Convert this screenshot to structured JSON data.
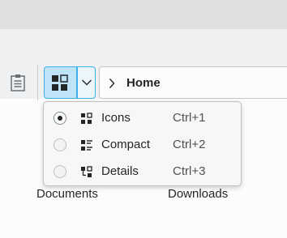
{
  "window": {
    "location_crumb": "Home"
  },
  "view_mode_menu": {
    "items": [
      {
        "label": "Icons",
        "shortcut": "Ctrl+1",
        "checked": true,
        "icon": "view-icons-icon"
      },
      {
        "label": "Compact",
        "shortcut": "Ctrl+2",
        "checked": false,
        "icon": "view-compact-icon"
      },
      {
        "label": "Details",
        "shortcut": "Ctrl+3",
        "checked": false,
        "icon": "view-details-icon"
      }
    ]
  },
  "files": [
    {
      "name": "Documents"
    },
    {
      "name": "Downloads"
    }
  ],
  "colors": {
    "accent": "#3daee9",
    "selected_bg": "#bfe3f7",
    "toolbar_bg": "#eff0f1",
    "titlebar_bg": "#dee0e2"
  }
}
